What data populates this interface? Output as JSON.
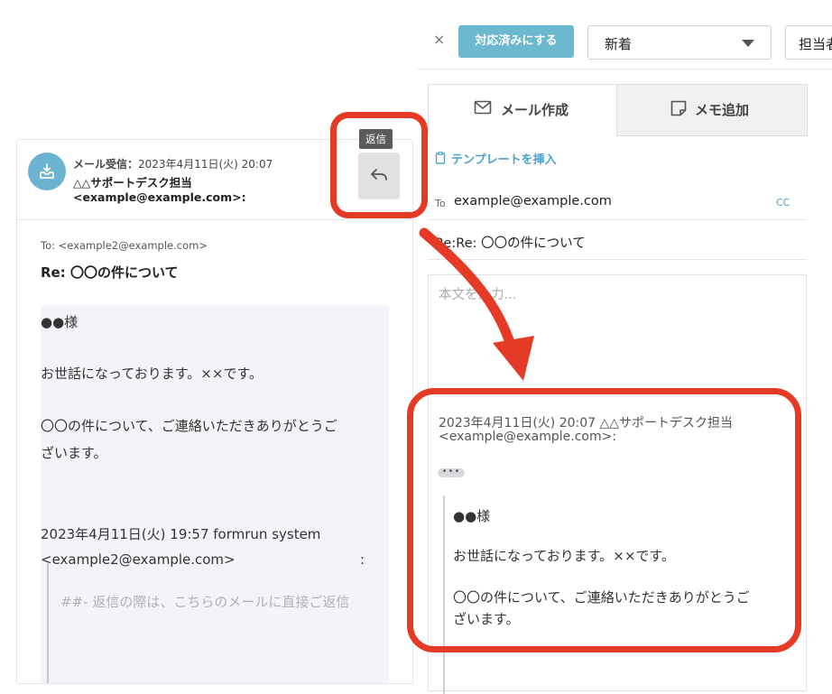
{
  "toolbar": {
    "close_glyph": "×",
    "done_label": "対応済みにする",
    "status_value": "新着",
    "assignee_value": "担当者"
  },
  "received": {
    "tooltip": "返信",
    "receive_label": "メール受信：",
    "receive_time": "2023年4月11日(火) 20:07",
    "sender_name": "△△サポートデスク担当",
    "sender_email": "<example@example.com>:",
    "to_line": "To: <example2@example.com>",
    "subject": "Re: 〇〇の件について",
    "body": {
      "greeting": "●●様",
      "line1": "お世話になっております。××です。",
      "line2a": "〇〇の件について、ご連絡いただきありがとうご",
      "line2b": "ざいます。",
      "quote_date": "2023年4月11日(火) 19:57 formrun system",
      "quote_email": "<example2@example.com>",
      "quote_colon": ":",
      "quote_text": "##- 返信の際は、こちらのメールに直接ご返信"
    }
  },
  "composer": {
    "tabs": [
      {
        "label": "メール作成",
        "icon": "mail-icon",
        "active": true
      },
      {
        "label": "メモ追加",
        "icon": "note-icon",
        "active": false
      }
    ],
    "template_link": "テンプレートを挿入",
    "to_label": "To",
    "to_address": "example@example.com",
    "cc_label": "CC",
    "subject": "Re:Re: 〇〇の件について",
    "placeholder": "本文を入力...",
    "quote": {
      "header1": "2023年4月11日(火) 20:07 △△サポートデスク担当",
      "header2": "<example@example.com>:",
      "ellipsis": "•••",
      "greeting": "●●様",
      "line1": "お世話になっております。××です。",
      "line2a": "〇〇の件について、ご連絡いただきありがとうご",
      "line2b": "ざいます。"
    }
  },
  "colors": {
    "accent": "#6cb8cf",
    "link": "#4aa3c7",
    "annotation_red": "#e53b26"
  }
}
